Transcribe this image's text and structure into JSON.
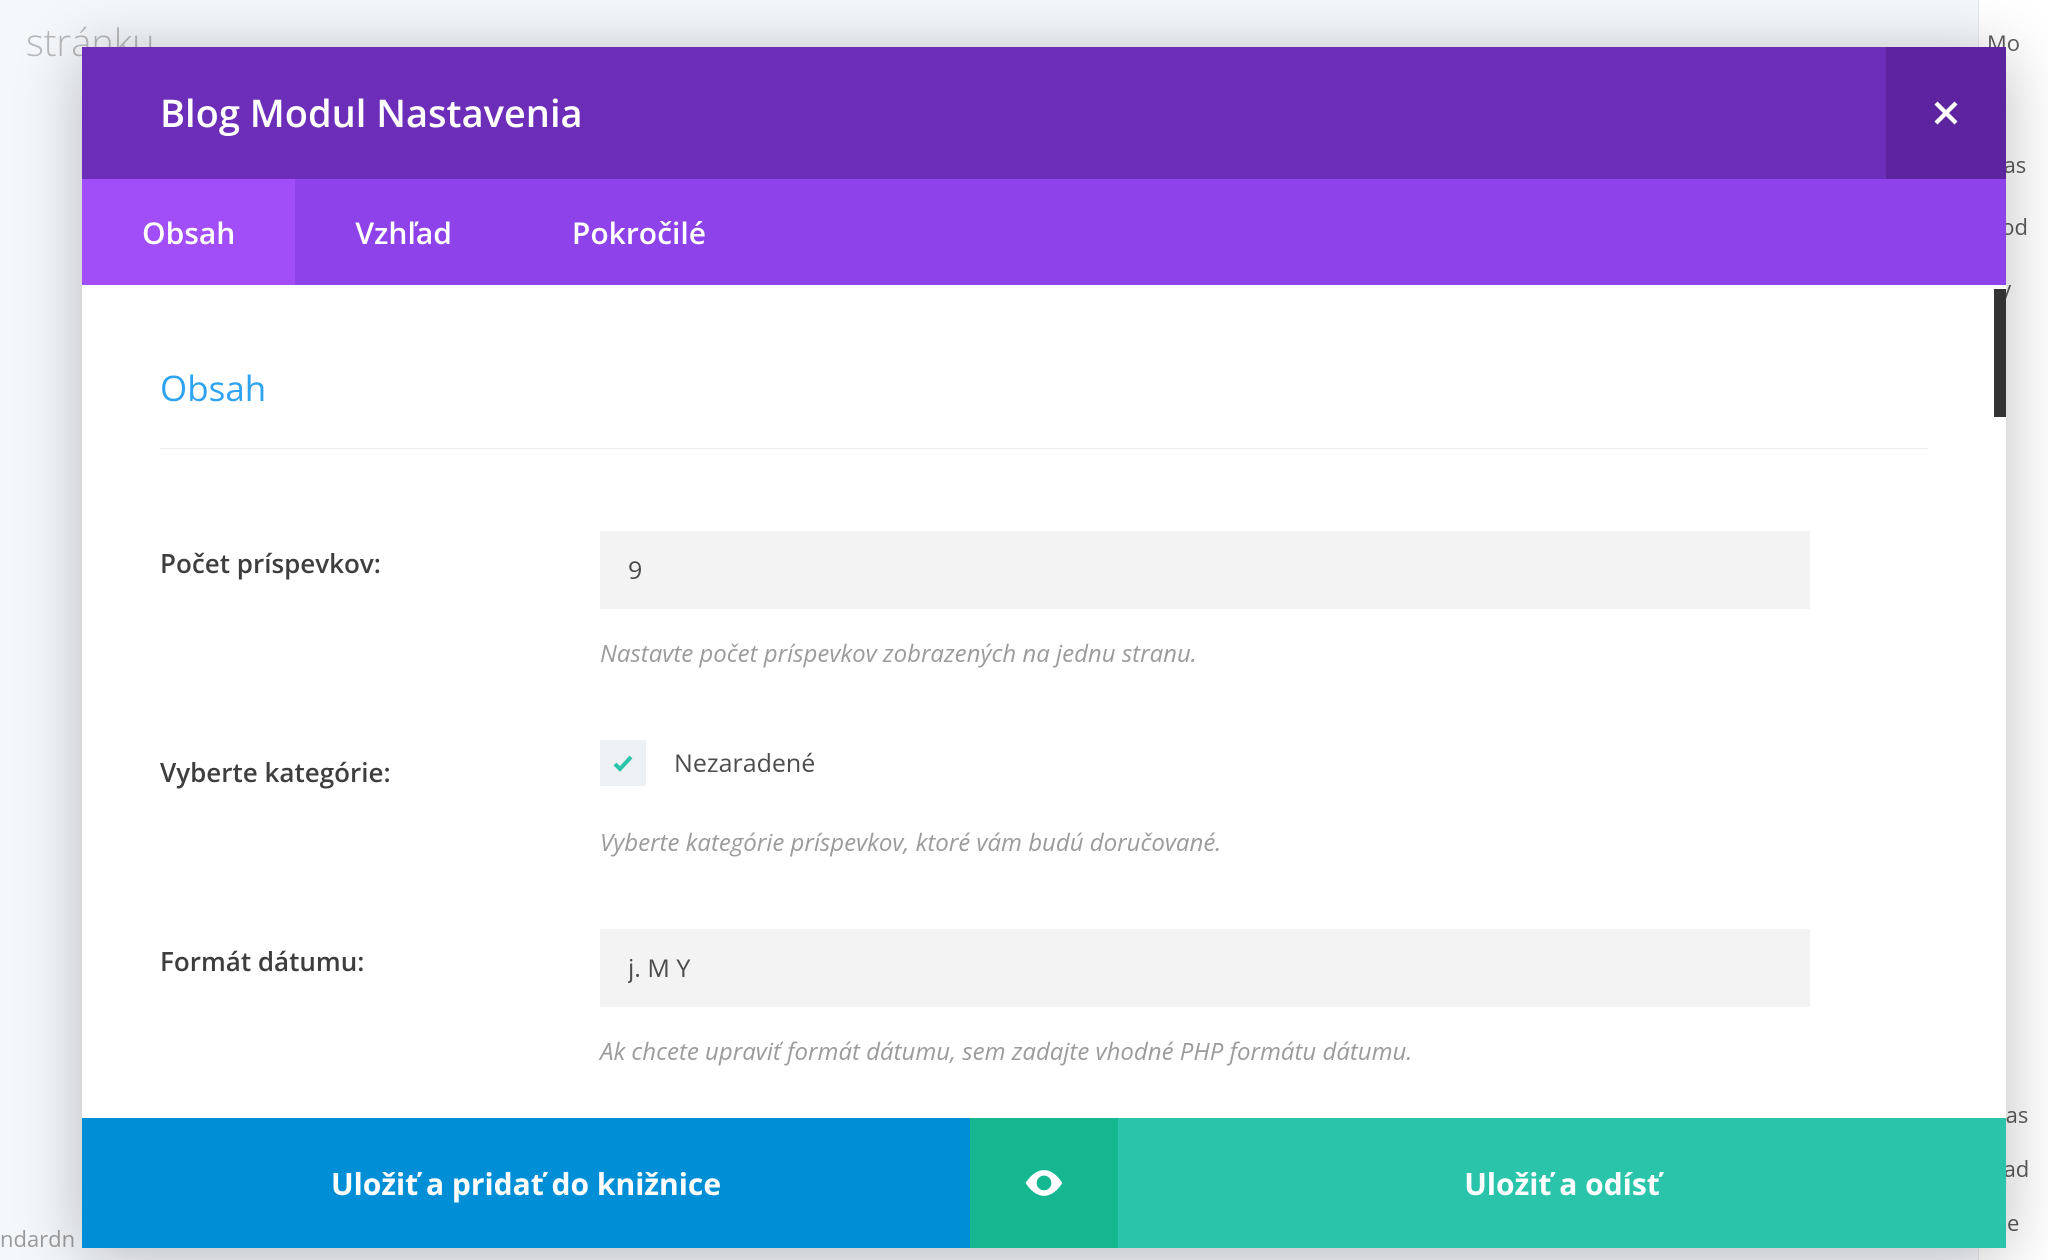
{
  "background": {
    "top_left": "stránku",
    "right_items": [
      "Mo",
      "Nas",
      "Bod",
      "Vy"
    ],
    "right_bottom": [
      "Vlas",
      "Nad",
      "(be"
    ],
    "bottom_left": "ndardn"
  },
  "modal": {
    "title": "Blog Modul Nastavenia",
    "tabs": [
      {
        "label": "Obsah",
        "active": true
      },
      {
        "label": "Vzhľad",
        "active": false
      },
      {
        "label": "Pokročilé",
        "active": false
      }
    ]
  },
  "section": {
    "title": "Obsah"
  },
  "fields": {
    "posts": {
      "label": "Počet príspevkov:",
      "value": "9",
      "hint": "Nastavte počet príspevkov zobrazených na jednu stranu."
    },
    "categories": {
      "label": "Vyberte kategórie:",
      "option_label": "Nezaradené",
      "hint": "Vyberte kategórie príspevkov, ktoré vám budú doručované."
    },
    "date_format": {
      "label": "Formát dátumu:",
      "value": "j. M Y",
      "hint": "Ak chcete upraviť formát dátumu, sem zadajte vhodné PHP formátu dátumu."
    }
  },
  "footer": {
    "library": "Uložiť a pridať do knižnice",
    "save_exit": "Uložiť a odísť"
  }
}
